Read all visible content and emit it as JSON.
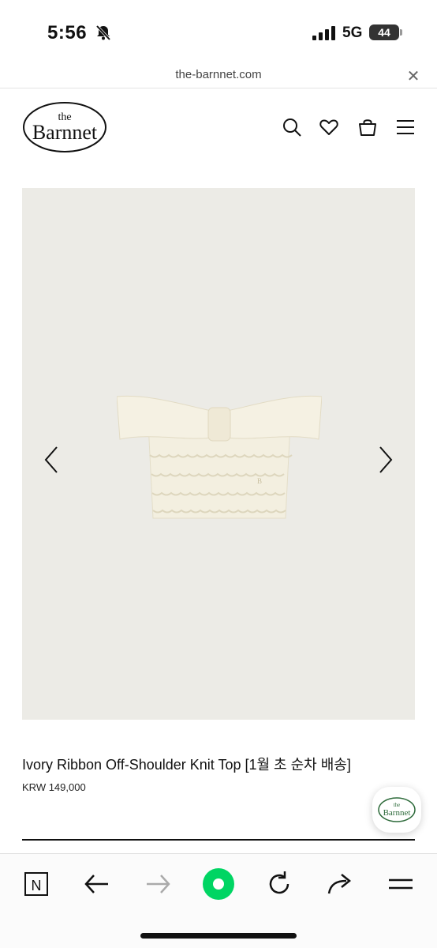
{
  "status_bar": {
    "time": "5:56",
    "network": "5G",
    "battery": "44"
  },
  "url_bar": {
    "url": "the-barnnet.com"
  },
  "site": {
    "logo_top": "the",
    "logo_main": "Barnnet"
  },
  "product": {
    "title": "Ivory Ribbon Off-Shoulder Knit Top [1월 초 순차 배송]",
    "price": "KRW 149,000"
  },
  "icons": {
    "header": [
      "search-icon",
      "heart-icon",
      "bag-icon",
      "menu-icon"
    ],
    "toolbar": [
      "naver-icon",
      "back-icon",
      "forward-icon",
      "green-dot-icon",
      "reload-icon",
      "share-icon",
      "menu-lines-icon"
    ]
  },
  "colors": {
    "image_bg": "#ecebe6",
    "knit": "#f3efe0",
    "accent_green": "#00d563",
    "logo_green": "#2e6b3b"
  }
}
